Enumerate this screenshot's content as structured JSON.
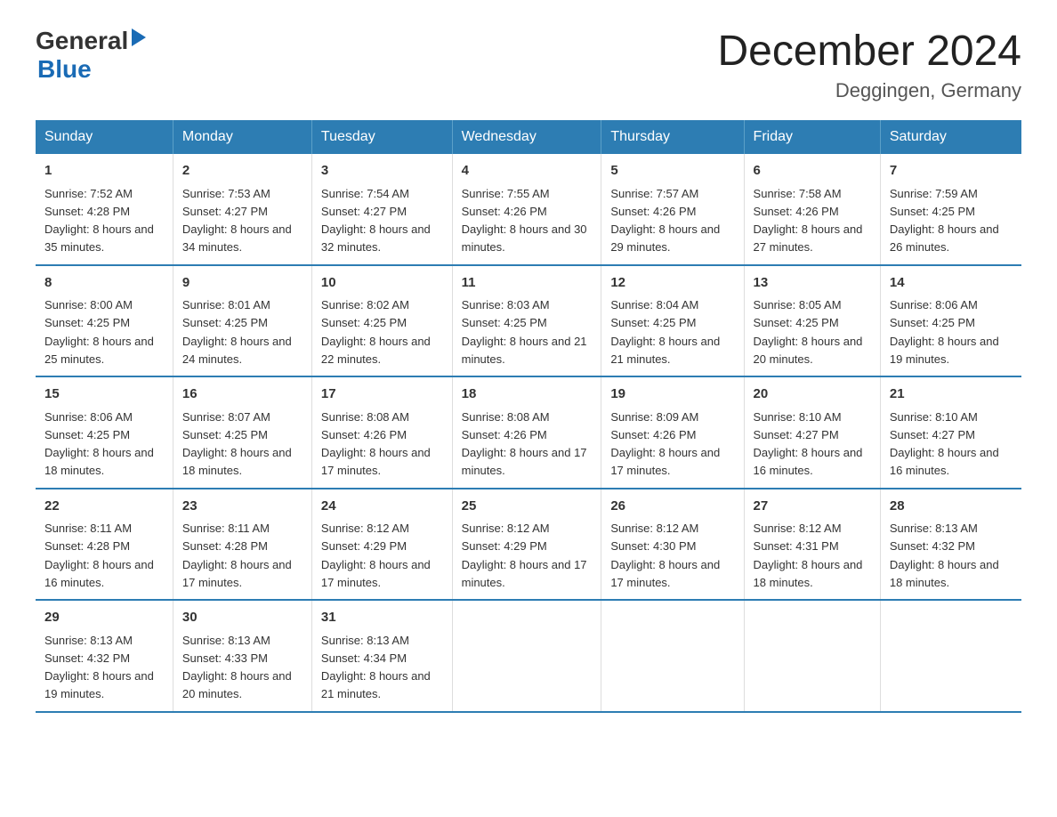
{
  "logo": {
    "general": "General",
    "blue": "Blue",
    "tagline": ""
  },
  "header": {
    "title": "December 2024",
    "location": "Deggingen, Germany"
  },
  "days_of_week": [
    "Sunday",
    "Monday",
    "Tuesday",
    "Wednesday",
    "Thursday",
    "Friday",
    "Saturday"
  ],
  "weeks": [
    [
      {
        "day": "1",
        "sunrise": "7:52 AM",
        "sunset": "4:28 PM",
        "daylight": "8 hours and 35 minutes."
      },
      {
        "day": "2",
        "sunrise": "7:53 AM",
        "sunset": "4:27 PM",
        "daylight": "8 hours and 34 minutes."
      },
      {
        "day": "3",
        "sunrise": "7:54 AM",
        "sunset": "4:27 PM",
        "daylight": "8 hours and 32 minutes."
      },
      {
        "day": "4",
        "sunrise": "7:55 AM",
        "sunset": "4:26 PM",
        "daylight": "8 hours and 30 minutes."
      },
      {
        "day": "5",
        "sunrise": "7:57 AM",
        "sunset": "4:26 PM",
        "daylight": "8 hours and 29 minutes."
      },
      {
        "day": "6",
        "sunrise": "7:58 AM",
        "sunset": "4:26 PM",
        "daylight": "8 hours and 27 minutes."
      },
      {
        "day": "7",
        "sunrise": "7:59 AM",
        "sunset": "4:25 PM",
        "daylight": "8 hours and 26 minutes."
      }
    ],
    [
      {
        "day": "8",
        "sunrise": "8:00 AM",
        "sunset": "4:25 PM",
        "daylight": "8 hours and 25 minutes."
      },
      {
        "day": "9",
        "sunrise": "8:01 AM",
        "sunset": "4:25 PM",
        "daylight": "8 hours and 24 minutes."
      },
      {
        "day": "10",
        "sunrise": "8:02 AM",
        "sunset": "4:25 PM",
        "daylight": "8 hours and 22 minutes."
      },
      {
        "day": "11",
        "sunrise": "8:03 AM",
        "sunset": "4:25 PM",
        "daylight": "8 hours and 21 minutes."
      },
      {
        "day": "12",
        "sunrise": "8:04 AM",
        "sunset": "4:25 PM",
        "daylight": "8 hours and 21 minutes."
      },
      {
        "day": "13",
        "sunrise": "8:05 AM",
        "sunset": "4:25 PM",
        "daylight": "8 hours and 20 minutes."
      },
      {
        "day": "14",
        "sunrise": "8:06 AM",
        "sunset": "4:25 PM",
        "daylight": "8 hours and 19 minutes."
      }
    ],
    [
      {
        "day": "15",
        "sunrise": "8:06 AM",
        "sunset": "4:25 PM",
        "daylight": "8 hours and 18 minutes."
      },
      {
        "day": "16",
        "sunrise": "8:07 AM",
        "sunset": "4:25 PM",
        "daylight": "8 hours and 18 minutes."
      },
      {
        "day": "17",
        "sunrise": "8:08 AM",
        "sunset": "4:26 PM",
        "daylight": "8 hours and 17 minutes."
      },
      {
        "day": "18",
        "sunrise": "8:08 AM",
        "sunset": "4:26 PM",
        "daylight": "8 hours and 17 minutes."
      },
      {
        "day": "19",
        "sunrise": "8:09 AM",
        "sunset": "4:26 PM",
        "daylight": "8 hours and 17 minutes."
      },
      {
        "day": "20",
        "sunrise": "8:10 AM",
        "sunset": "4:27 PM",
        "daylight": "8 hours and 16 minutes."
      },
      {
        "day": "21",
        "sunrise": "8:10 AM",
        "sunset": "4:27 PM",
        "daylight": "8 hours and 16 minutes."
      }
    ],
    [
      {
        "day": "22",
        "sunrise": "8:11 AM",
        "sunset": "4:28 PM",
        "daylight": "8 hours and 16 minutes."
      },
      {
        "day": "23",
        "sunrise": "8:11 AM",
        "sunset": "4:28 PM",
        "daylight": "8 hours and 17 minutes."
      },
      {
        "day": "24",
        "sunrise": "8:12 AM",
        "sunset": "4:29 PM",
        "daylight": "8 hours and 17 minutes."
      },
      {
        "day": "25",
        "sunrise": "8:12 AM",
        "sunset": "4:29 PM",
        "daylight": "8 hours and 17 minutes."
      },
      {
        "day": "26",
        "sunrise": "8:12 AM",
        "sunset": "4:30 PM",
        "daylight": "8 hours and 17 minutes."
      },
      {
        "day": "27",
        "sunrise": "8:12 AM",
        "sunset": "4:31 PM",
        "daylight": "8 hours and 18 minutes."
      },
      {
        "day": "28",
        "sunrise": "8:13 AM",
        "sunset": "4:32 PM",
        "daylight": "8 hours and 18 minutes."
      }
    ],
    [
      {
        "day": "29",
        "sunrise": "8:13 AM",
        "sunset": "4:32 PM",
        "daylight": "8 hours and 19 minutes."
      },
      {
        "day": "30",
        "sunrise": "8:13 AM",
        "sunset": "4:33 PM",
        "daylight": "8 hours and 20 minutes."
      },
      {
        "day": "31",
        "sunrise": "8:13 AM",
        "sunset": "4:34 PM",
        "daylight": "8 hours and 21 minutes."
      },
      null,
      null,
      null,
      null
    ]
  ],
  "labels": {
    "sunrise": "Sunrise:",
    "sunset": "Sunset:",
    "daylight": "Daylight:"
  }
}
